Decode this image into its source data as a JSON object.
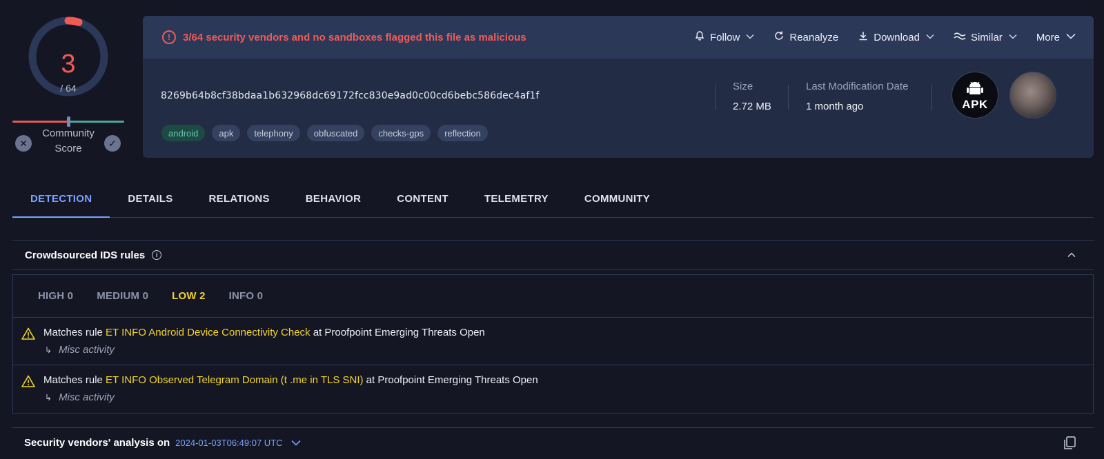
{
  "score": {
    "detections": "3",
    "total": "/ 64",
    "community_label": "Community Score",
    "ring_fraction": 0.047
  },
  "header": {
    "alert_text": "3/64 security vendors and no sandboxes flagged this file as malicious",
    "actions": [
      {
        "label": "Follow",
        "icon": "bell-icon",
        "has_chevron": true
      },
      {
        "label": "Reanalyze",
        "icon": "refresh-icon",
        "has_chevron": false
      },
      {
        "label": "Download",
        "icon": "download-icon",
        "has_chevron": true
      },
      {
        "label": "Similar",
        "icon": "similar-icon",
        "has_chevron": true
      },
      {
        "label": "More",
        "icon": "",
        "has_chevron": true
      }
    ],
    "hash": "8269b64b8cf38bdaa1b632968dc69172fcc830e9ad0c00cd6bebc586dec4af1f",
    "tags": [
      "android",
      "apk",
      "telephony",
      "obfuscated",
      "checks-gps",
      "reflection"
    ],
    "size_label": "Size",
    "size_value": "2.72 MB",
    "modified_label": "Last Modification Date",
    "modified_value": "1 month ago",
    "file_type": "APK"
  },
  "tabs": [
    "DETECTION",
    "DETAILS",
    "RELATIONS",
    "BEHAVIOR",
    "CONTENT",
    "TELEMETRY",
    "COMMUNITY"
  ],
  "active_tab": "DETECTION",
  "ids": {
    "title": "Crowdsourced IDS rules",
    "severities": [
      {
        "label": "HIGH 0",
        "active": false
      },
      {
        "label": "MEDIUM 0",
        "active": false
      },
      {
        "label": "LOW 2",
        "active": true
      },
      {
        "label": "INFO 0",
        "active": false
      }
    ],
    "rules": [
      {
        "prefix": "Matches rule ",
        "rule": "ET INFO Android Device Connectivity Check",
        "suffix": " at Proofpoint Emerging Threats Open",
        "category": "Misc activity"
      },
      {
        "prefix": "Matches rule ",
        "rule": "ET INFO Observed Telegram Domain (t .me in TLS SNI)",
        "suffix": " at Proofpoint Emerging Threats Open",
        "category": "Misc activity"
      }
    ]
  },
  "vendors": {
    "title": "Security vendors' analysis on",
    "date": "2024-01-03T06:49:07 UTC"
  },
  "colors": {
    "malicious": "#f05b56",
    "accent": "#7aa2ff",
    "low_severity": "#f3d52a",
    "background": "#151624"
  }
}
